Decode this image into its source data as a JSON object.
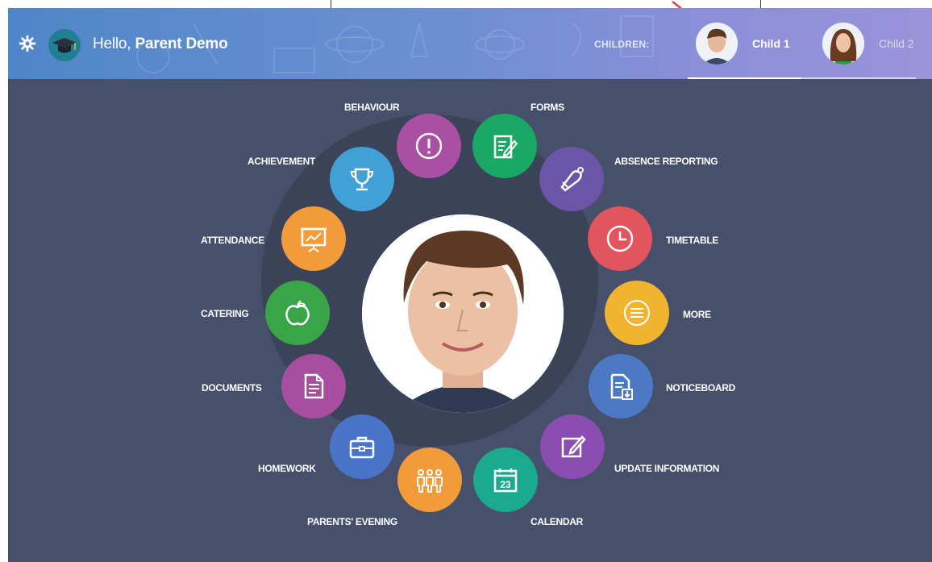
{
  "header": {
    "greeting": "Hello,",
    "user_name": "Parent Demo",
    "children_label": "CHILDREN:",
    "children": [
      {
        "name": "Child 1",
        "selected": true
      },
      {
        "name": "Child 2",
        "selected": false
      }
    ],
    "background_colors": [
      "#4f86c9",
      "#9b93da"
    ]
  },
  "menu": [
    {
      "label": "BEHAVIOUR",
      "icon": "exclamation-icon",
      "color": "#a94fa4"
    },
    {
      "label": "FORMS",
      "icon": "form-edit-icon",
      "color": "#1aa864"
    },
    {
      "label": "ABSENCE REPORTING",
      "icon": "bell-icon",
      "color": "#6a55a7"
    },
    {
      "label": "TIMETABLE",
      "icon": "clock-icon",
      "color": "#e2545e"
    },
    {
      "label": "MORE",
      "icon": "menu-lines-icon",
      "color": "#f0b431"
    },
    {
      "label": "NOTICEBOARD",
      "icon": "document-download-icon",
      "color": "#4d79c4"
    },
    {
      "label": "UPDATE INFORMATION",
      "icon": "pencil-square-icon",
      "color": "#8c4db2"
    },
    {
      "label": "CALENDAR",
      "icon": "calendar-icon",
      "color": "#1aaa90"
    },
    {
      "label": "PARENTS' EVENING",
      "icon": "people-icon",
      "color": "#f29b3a"
    },
    {
      "label": "HOMEWORK",
      "icon": "briefcase-icon",
      "color": "#4a74c8"
    },
    {
      "label": "DOCUMENTS",
      "icon": "document-icon",
      "color": "#a84ea1"
    },
    {
      "label": "CATERING",
      "icon": "apple-icon",
      "color": "#3aa547"
    },
    {
      "label": "ATTENDANCE",
      "icon": "presentation-chart-icon",
      "color": "#f29b3a"
    },
    {
      "label": "ACHIEVEMENT",
      "icon": "trophy-icon",
      "color": "#3fa1d6"
    }
  ],
  "calendar_day": "23",
  "colors": {
    "main_background": "#47506a",
    "ring": "#3b4358"
  }
}
